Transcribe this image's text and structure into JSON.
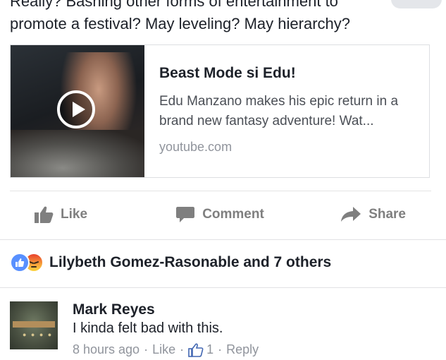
{
  "post": {
    "text_line1": "Really? Bashing other forms of entertainment to",
    "text_line2": "promote a festival? May leveling? May hierarchy?"
  },
  "link_card": {
    "title": "Beast Mode si Edu!",
    "description": "Edu Manzano makes his epic return in a brand new fantasy adventure! Wat...",
    "domain": "youtube.com",
    "thumbnail_icon": "play-icon"
  },
  "actions": {
    "like_label": "Like",
    "comment_label": "Comment",
    "share_label": "Share"
  },
  "reactions": {
    "icons": [
      "like-reaction-icon",
      "angry-reaction-icon"
    ],
    "summary": "Lilybeth Gomez-Rasonable and 7 others"
  },
  "comment": {
    "author": "Mark Reyes",
    "text": "I kinda felt bad with this.",
    "time": "8 hours ago",
    "like_label": "Like",
    "like_count": "1",
    "reply_label": "Reply",
    "separator": "·"
  },
  "colors": {
    "text": "#1d2129",
    "muted": "#90949c",
    "action": "#7f7f7f",
    "like_blue": "#5890ff"
  }
}
